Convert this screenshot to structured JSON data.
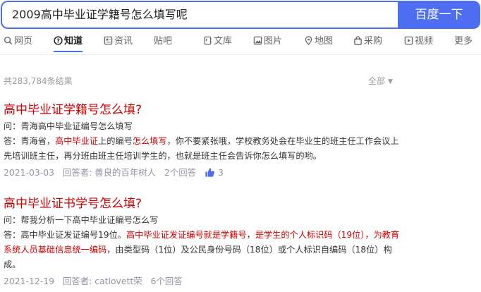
{
  "search": {
    "query": "2009高中毕业证学籍号怎么填写呢",
    "button_label": "百度一下"
  },
  "tabs": [
    {
      "label": "网页",
      "icon": "search-icon"
    },
    {
      "label": "知道",
      "icon": "question-icon",
      "active": true
    },
    {
      "label": "资讯",
      "icon": "news-icon"
    },
    {
      "label": "贴吧",
      "icon": "tieba-icon"
    },
    {
      "label": "文库",
      "icon": "document-icon"
    },
    {
      "label": "图片",
      "icon": "image-icon"
    },
    {
      "label": "地图",
      "icon": "map-pin-icon"
    },
    {
      "label": "采购",
      "icon": "shopping-bag-icon"
    },
    {
      "label": "视频",
      "icon": "video-icon"
    },
    {
      "label": "更多",
      "icon": ""
    }
  ],
  "results_summary": {
    "count_text": "共283,784条结果",
    "filter_label": "全部"
  },
  "results": [
    {
      "title": "高中毕业证学籍号怎么填?",
      "question": "问：青海高中毕业证编号怎么填写",
      "answer_parts": [
        {
          "text": "答：青海省，",
          "em": false
        },
        {
          "text": "高中毕业证",
          "em": true
        },
        {
          "text": "上的编号",
          "em": false
        },
        {
          "text": "怎么填写",
          "em": true
        },
        {
          "text": "，你不要紧张哦，学校教务处会在毕业生的班主任工作会议上先培训班主任，再分班由班主任培训学生的，也就是班主任会告诉你怎么填写的哟。",
          "em": false
        }
      ],
      "date": "2021-03-03",
      "answerer": "回答者: 善良的百年树人",
      "answer_count": "2个回答",
      "likes": "3"
    },
    {
      "title": "高中毕业证书学号怎么填?",
      "question": "问：帮我分析一下高中毕业证编号怎么写",
      "answer_parts": [
        {
          "text": "答：高中毕业证发证编号19位。",
          "em": false
        },
        {
          "text": "高中毕业证发证编号就是学籍号",
          "em": true
        },
        {
          "text": "，",
          "em": false
        },
        {
          "text": "是学生的个人标识码（19位），为教育系统人员基础信息统一编码",
          "em": true
        },
        {
          "text": "，由类型码（1位）及公民身份号码（18位）或个人标识自编码（18位）构成。",
          "em": false
        }
      ],
      "date": "2021-12-19",
      "answerer": "回答者: catlovett荣",
      "answer_count": "6个回答"
    }
  ],
  "colors": {
    "accent": "#4e6ef2",
    "link": "#2440b3",
    "highlight": "#cc0000",
    "meta": "#9195a3"
  }
}
